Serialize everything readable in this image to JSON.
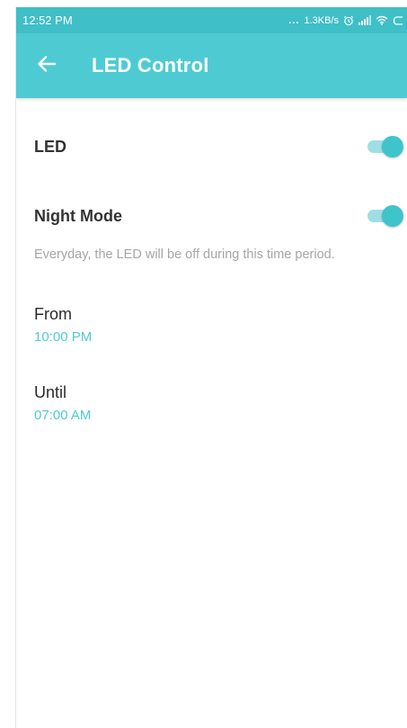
{
  "status_bar": {
    "time": "12:52 PM",
    "more": "...",
    "network_speed": "1.3KB/s",
    "icons": [
      "alarm-icon",
      "signal-icon",
      "wifi-icon",
      "battery-icon"
    ]
  },
  "app_bar": {
    "back_icon": "arrow-left-icon",
    "title": "LED Control",
    "color": "#4ecbd2"
  },
  "settings": {
    "led": {
      "label": "LED",
      "enabled": true
    },
    "night_mode": {
      "label": "Night Mode",
      "enabled": true,
      "description": "Everyday, the LED will be off during this time period."
    },
    "from": {
      "label": "From",
      "value": "10:00 PM"
    },
    "until": {
      "label": "Until",
      "value": "07:00 AM"
    }
  },
  "colors": {
    "accent": "#4ecbd2",
    "status_bar": "#3fbfc7",
    "toggle_track": "#9fdfe3",
    "toggle_thumb": "#3fc4cc"
  }
}
